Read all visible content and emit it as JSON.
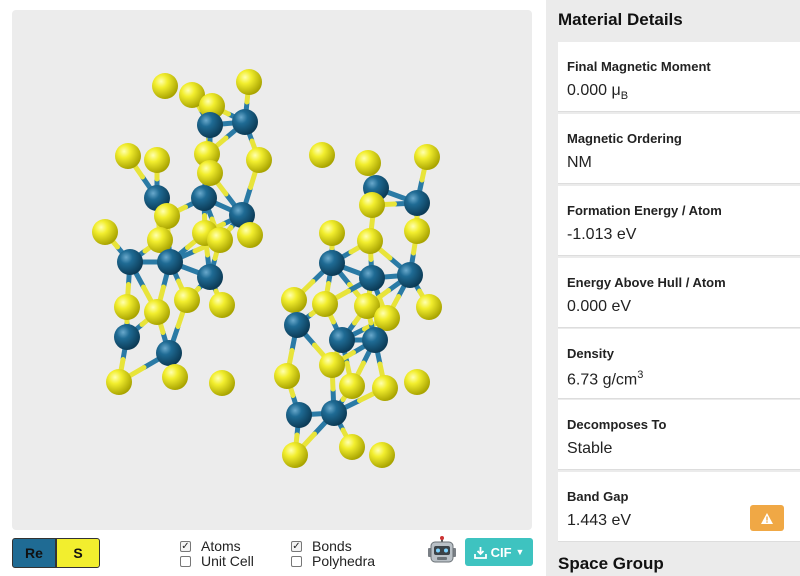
{
  "viewer": {
    "colors": {
      "re": "#1f6b94",
      "s": "#f2ee2e",
      "background": "#ececec"
    }
  },
  "legend": {
    "re_label": "Re",
    "s_label": "S"
  },
  "toggles": {
    "atoms": {
      "label": "Atoms",
      "checked": true
    },
    "unit_cell": {
      "label": "Unit Cell",
      "checked": false
    },
    "bonds": {
      "label": "Bonds",
      "checked": true
    },
    "polyhedra": {
      "label": "Polyhedra",
      "checked": false
    }
  },
  "export": {
    "label": "CIF",
    "icon": "download-icon"
  },
  "material_details": {
    "title": "Material Details",
    "properties": [
      {
        "label": "Final Magnetic Moment",
        "value": "0.000",
        "unit": "μ",
        "unit_sub": "B"
      },
      {
        "label": "Magnetic Ordering",
        "value": "NM"
      },
      {
        "label": "Formation Energy / Atom",
        "value": "-1.013 eV"
      },
      {
        "label": "Energy Above Hull / Atom",
        "value": "0.000 eV"
      },
      {
        "label": "Density",
        "value": "6.73 g/cm",
        "unit_sup": "3"
      },
      {
        "label": "Decomposes To",
        "value": "Stable"
      },
      {
        "label": "Band Gap",
        "value": "1.443 eV",
        "icon": "warning-icon"
      }
    ]
  },
  "space_group": {
    "title": "Space Group"
  }
}
